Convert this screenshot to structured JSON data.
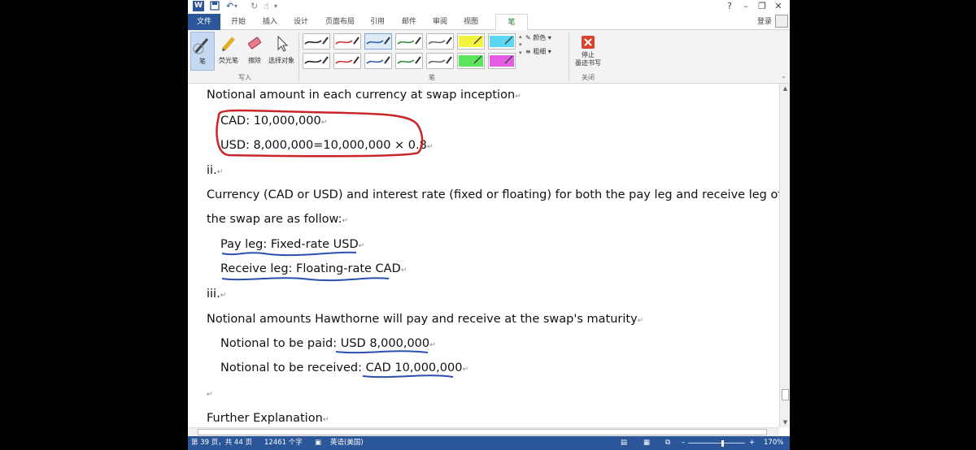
{
  "titlebar": {
    "word_icon": "word-icon",
    "save_icon": "save-icon",
    "undo_icon": "undo-icon",
    "redo_icon": "redo-icon",
    "touch_icon": "touch-mode-icon",
    "help": "?",
    "minimize": "–",
    "restore": "❐",
    "close": "✕"
  },
  "tabs": {
    "file": "文件",
    "items": [
      "开始",
      "插入",
      "设计",
      "页面布局",
      "引用",
      "邮件",
      "审阅",
      "视图",
      "笔"
    ],
    "active": "笔",
    "login": "登录"
  },
  "ribbon": {
    "write_group": {
      "label": "写入",
      "buttons": [
        "笔",
        "荧光笔",
        "擦除",
        "选择对象"
      ],
      "selected": "笔"
    },
    "pens_group": {
      "label": "笔",
      "color_label": "颜色",
      "thickness_label": "粗细",
      "pen_colors_row1": [
        "#222222",
        "#d03030",
        "#2e5fb0",
        "#2e8b3e",
        "#666666",
        "#f0f020",
        "#40d0f0"
      ],
      "pen_colors_row2": [
        "#222222",
        "#d03030",
        "#2e5fb0",
        "#2e8b3e",
        "#666666",
        "#40e040",
        "#e040e0"
      ]
    },
    "close_group": {
      "label": "关闭",
      "button_line1": "停止",
      "button_line2": "墨迹书写"
    }
  },
  "document": {
    "lines": [
      "Notional amount in each currency at swap inception",
      "CAD: 10,000,000",
      "USD: 8,000,000=10,000,000 × 0.8",
      "ii.",
      "Currency (CAD or USD) and interest rate (fixed or floating) for both the pay leg and receive leg of",
      "the swap are as follow:",
      "Pay leg: Fixed-rate USD",
      "Receive leg: Floating-rate CAD",
      "iii.",
      "Notional amounts Hawthorne will pay and receive at the swap's maturity",
      "Notional to be paid: USD 8,000,000",
      "Notional to be received: CAD 10,000,000",
      "",
      "Further Explanation"
    ],
    "paragraph_mark": "↵",
    "ink_colors": {
      "red": "#c8262b",
      "blue": "#2a4fae"
    }
  },
  "statusbar": {
    "page": "第 39 页，共 44 页",
    "words": "12461 个字",
    "language": "英语(美国)",
    "zoom": "170%",
    "zoom_minus": "–",
    "zoom_plus": "+"
  }
}
